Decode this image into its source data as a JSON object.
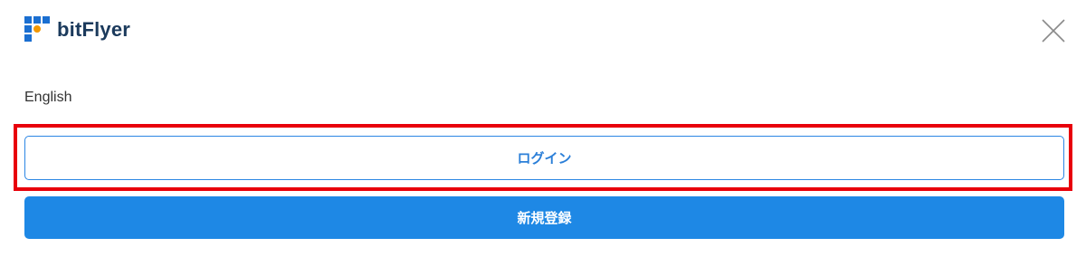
{
  "header": {
    "logo_text": "bitFlyer",
    "logo_icon": "bitflyer-logo-icon",
    "close_icon": "close-icon"
  },
  "menu": {
    "language_label": "English"
  },
  "actions": {
    "login_label": "ログイン",
    "register_label": "新規登録",
    "highlighted": "login"
  },
  "colors": {
    "brand_navy": "#1b3a5c",
    "accent_blue": "#1e88e5",
    "logo_orange": "#f39800",
    "highlight_red": "#e8000b"
  }
}
